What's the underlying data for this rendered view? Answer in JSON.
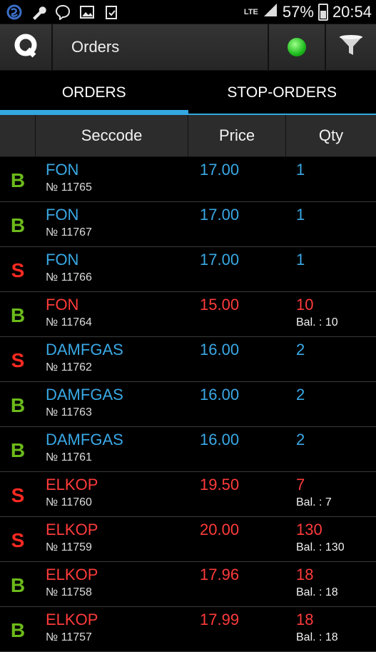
{
  "status_bar": {
    "icons": [
      "skype-icon",
      "wrench-icon",
      "viber-icon",
      "image-icon",
      "clipboard-icon"
    ],
    "network": "LTE",
    "battery": "57%",
    "time": "20:54"
  },
  "app_bar": {
    "title": "Orders",
    "connection_status_color": "#1dbb1d"
  },
  "tabs": [
    {
      "label": "ORDERS",
      "active": true
    },
    {
      "label": "STOP-ORDERS",
      "active": false
    }
  ],
  "table": {
    "columns": [
      "",
      "Seccode",
      "Price",
      "Qty"
    ],
    "rows": [
      {
        "side": "B",
        "seccode": "FON",
        "number": "№ 11765",
        "price": "17.00",
        "qty": "1",
        "balance": "",
        "color": "blue"
      },
      {
        "side": "B",
        "seccode": "FON",
        "number": "№ 11767",
        "price": "17.00",
        "qty": "1",
        "balance": "",
        "color": "blue"
      },
      {
        "side": "S",
        "seccode": "FON",
        "number": "№ 11766",
        "price": "17.00",
        "qty": "1",
        "balance": "",
        "color": "blue"
      },
      {
        "side": "B",
        "seccode": "FON",
        "number": "№ 11764",
        "price": "15.00",
        "qty": "10",
        "balance": "Bal. : 10",
        "color": "red"
      },
      {
        "side": "S",
        "seccode": "DAMFGAS",
        "number": "№ 11762",
        "price": "16.00",
        "qty": "2",
        "balance": "",
        "color": "blue"
      },
      {
        "side": "B",
        "seccode": "DAMFGAS",
        "number": "№ 11763",
        "price": "16.00",
        "qty": "2",
        "balance": "",
        "color": "blue"
      },
      {
        "side": "B",
        "seccode": "DAMFGAS",
        "number": "№ 11761",
        "price": "16.00",
        "qty": "2",
        "balance": "",
        "color": "blue"
      },
      {
        "side": "S",
        "seccode": "ELKOP",
        "number": "№ 11760",
        "price": "19.50",
        "qty": "7",
        "balance": "Bal. : 7",
        "color": "red"
      },
      {
        "side": "S",
        "seccode": "ELKOP",
        "number": "№ 11759",
        "price": "20.00",
        "qty": "130",
        "balance": "Bal. : 130",
        "color": "red"
      },
      {
        "side": "B",
        "seccode": "ELKOP",
        "number": "№ 11758",
        "price": "17.96",
        "qty": "18",
        "balance": "Bal. : 18",
        "color": "red"
      },
      {
        "side": "B",
        "seccode": "ELKOP",
        "number": "№ 11757",
        "price": "17.99",
        "qty": "18",
        "balance": "Bal. : 18",
        "color": "red"
      }
    ]
  },
  "colors": {
    "buy": "#6cbb1a",
    "sell": "#ff2a22",
    "active_order": "#3aa9e6",
    "partial_order": "#ff3b3b",
    "tab_accent": "#33a7e0"
  }
}
